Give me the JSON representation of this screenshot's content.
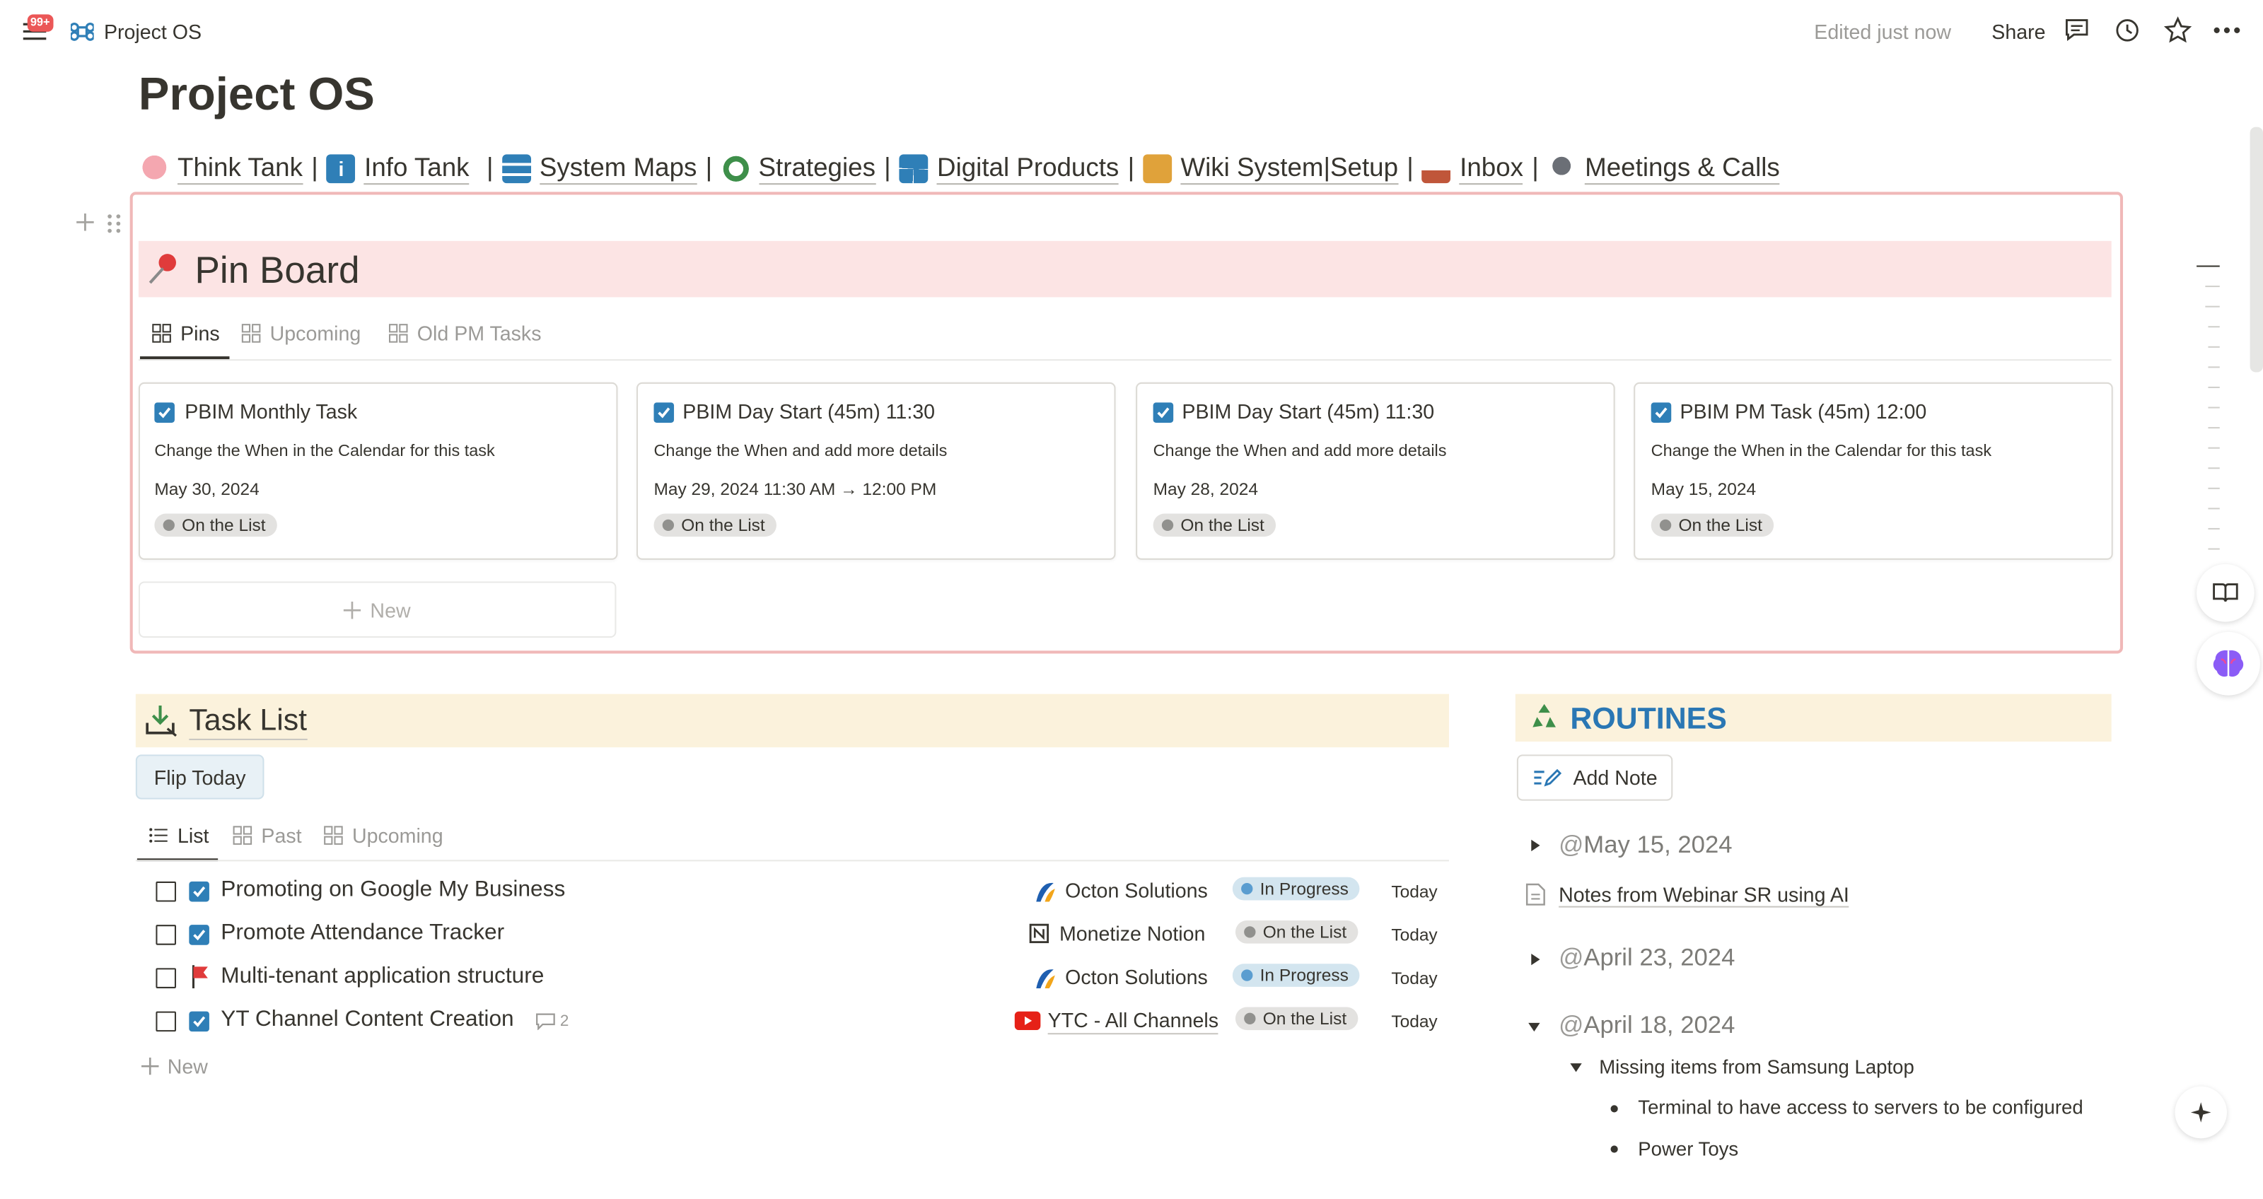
{
  "topbar": {
    "notification_count": "99+",
    "breadcrumb_title": "Project OS",
    "edited_status": "Edited just now",
    "share_label": "Share"
  },
  "page": {
    "title": "Project OS"
  },
  "nav_links": [
    {
      "label": "Think Tank",
      "sep": "|"
    },
    {
      "label": "Info Tank",
      "sep": "|"
    },
    {
      "label": "System Maps",
      "sep": "|"
    },
    {
      "label": "Strategies",
      "sep": "|"
    },
    {
      "label": "Digital Products",
      "sep": "|"
    },
    {
      "label": "Wiki System|Setup",
      "sep": "|"
    },
    {
      "label": "Inbox",
      "sep": "|"
    },
    {
      "label": "Meetings & Calls",
      "sep": ""
    }
  ],
  "pin_board": {
    "title": "Pin Board",
    "tabs": [
      "Pins",
      "Upcoming",
      "Old PM Tasks"
    ],
    "cards": [
      {
        "title": "PBIM Monthly Task",
        "desc": "Change the When in the Calendar for this task",
        "date": "May 30, 2024",
        "status": "On the List"
      },
      {
        "title": "PBIM Day Start (45m) 11:30",
        "desc": "Change the When and add more details",
        "date": "May 29, 2024 11:30 AM → 12:00 PM",
        "status": "On the List"
      },
      {
        "title": "PBIM Day Start (45m) 11:30",
        "desc": "Change the When and add more details",
        "date": "May 28, 2024",
        "status": "On the List"
      },
      {
        "title": "PBIM PM Task (45m) 12:00",
        "desc": "Change the When in the Calendar for this task",
        "date": "May 15, 2024",
        "status": "On the List"
      }
    ],
    "new_label": "New"
  },
  "task_list": {
    "title": "Task List",
    "flip_button": "Flip Today",
    "tabs": [
      "List",
      "Past",
      "Upcoming"
    ],
    "rows": [
      {
        "name": "Promoting on Google My Business",
        "project": "Octon Solutions",
        "status": "In Progress",
        "when": "Today",
        "comments": ""
      },
      {
        "name": "Promote Attendance Tracker",
        "project": "Monetize Notion",
        "status": "On the List",
        "when": "Today",
        "comments": ""
      },
      {
        "name": "Multi-tenant application structure",
        "project": "Octon Solutions",
        "status": "In Progress",
        "when": "Today",
        "comments": ""
      },
      {
        "name": "YT Channel Content Creation",
        "project": "YTC - All Channels",
        "status": "On the List",
        "when": "Today",
        "comments": "2"
      }
    ],
    "new_label": "New"
  },
  "routines": {
    "title": "ROUTINES",
    "add_note": "Add Note",
    "date1": "May 15, 2024",
    "note1": "Notes from Webinar SR using AI",
    "date2": "April 23, 2024",
    "date3": "April 18, 2024",
    "sub_toggle": "Missing items from Samsung Laptop",
    "bullets": [
      "Terminal to have access to servers to be configured",
      "Power Toys"
    ],
    "at": "@"
  },
  "colors": {
    "pin_border": "#f0b8b8",
    "pin_header": "#fce4e4",
    "section_band": "#fbf2dc",
    "accent_blue": "#2a77b4",
    "checkbox_blue": "#2f7fb7"
  }
}
